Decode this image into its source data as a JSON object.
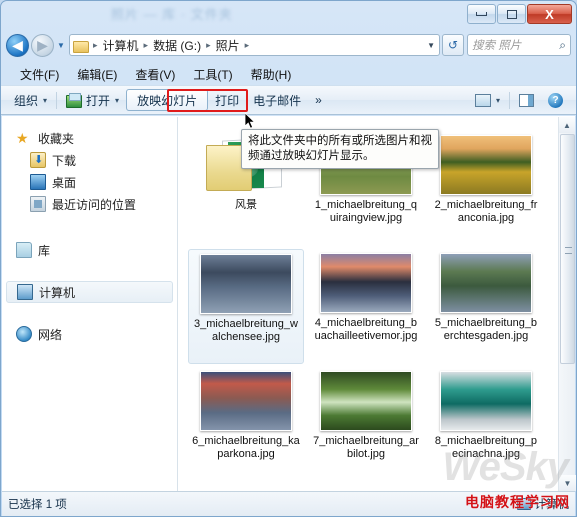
{
  "window": {
    "title_ghost": "照片 — 库  ·  文件夹",
    "controls": {
      "minimize": "–",
      "maximize": "□",
      "close": "X"
    }
  },
  "address": {
    "back_icon": "◀",
    "forward_icon": "▶",
    "history_icon": "▼",
    "folder_icon": "folder-icon",
    "crumbs": [
      "计算机",
      "数据 (G:)",
      "照片"
    ],
    "separator": "▸",
    "dropdown_icon": "▼",
    "refresh_icon": "↺",
    "search_placeholder": "搜索 照片",
    "search_value": "",
    "search_icon": "⌕"
  },
  "menubar": {
    "items": [
      "文件(F)",
      "编辑(E)",
      "查看(V)",
      "工具(T)",
      "帮助(H)"
    ]
  },
  "toolbar": {
    "organize": "组织",
    "open": "打开",
    "slideshow": "放映幻灯片",
    "print": "打印",
    "email": "电子邮件",
    "overflow": "»",
    "caret": "▾",
    "view_label": "view-icon",
    "pane_label": "preview-pane-icon",
    "help_label": "?",
    "highlight_color": "#e01b1b"
  },
  "tooltip": {
    "text": "将此文件夹中的所有或所选图片和视频通过放映幻灯片显示。"
  },
  "sidebar": {
    "groups": [
      {
        "header": {
          "label": "收藏夹",
          "icon": "star-icon"
        },
        "items": [
          {
            "label": "下载",
            "icon": "download-icon"
          },
          {
            "label": "桌面",
            "icon": "desktop-icon"
          },
          {
            "label": "最近访问的位置",
            "icon": "recent-places-icon"
          }
        ]
      },
      {
        "header": {
          "label": "库",
          "icon": "library-icon"
        },
        "items": []
      },
      {
        "header": {
          "label": "计算机",
          "icon": "computer-icon",
          "selected": true
        },
        "items": []
      },
      {
        "header": {
          "label": "网络",
          "icon": "network-icon"
        },
        "items": []
      }
    ]
  },
  "files": {
    "items": [
      {
        "name": "风景",
        "type": "folder",
        "selected": false,
        "thumb": "folder"
      },
      {
        "name": "1_michaelbreitung_quiraingview.jpg",
        "type": "image",
        "selected": false,
        "thumb": "t1"
      },
      {
        "name": "2_michaelbreitung_franconia.jpg",
        "type": "image",
        "selected": false,
        "thumb": "t2"
      },
      {
        "name": "3_michaelbreitung_walchensee.jpg",
        "type": "image",
        "selected": true,
        "thumb": "t3"
      },
      {
        "name": "4_michaelbreitung_buachailleetivemor.jpg",
        "type": "image",
        "selected": false,
        "thumb": "t4"
      },
      {
        "name": "5_michaelbreitung_berchtesgaden.jpg",
        "type": "image",
        "selected": false,
        "thumb": "t5"
      },
      {
        "name": "6_michaelbreitung_kaparkona.jpg",
        "type": "image",
        "selected": false,
        "thumb": "t6"
      },
      {
        "name": "7_michaelbreitung_arbilot.jpg",
        "type": "image",
        "selected": false,
        "thumb": "t7"
      },
      {
        "name": "8_michaelbreitung_pecinachna.jpg",
        "type": "image",
        "selected": false,
        "thumb": "t8"
      }
    ]
  },
  "scrollbar": {
    "up_icon": "▲",
    "down_icon": "▼"
  },
  "status": {
    "left": "已选择 1 项",
    "right": "计算机",
    "right_icon": "computer-icon"
  },
  "watermarks": {
    "big": "WeSky",
    "red": "电脑教程学习网"
  }
}
